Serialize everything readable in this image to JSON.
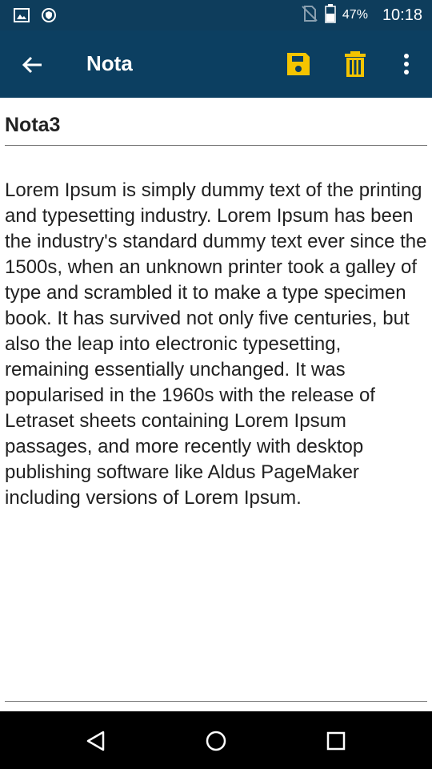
{
  "status_bar": {
    "battery_percent": "47%",
    "time": "10:18",
    "icons": [
      "image-icon",
      "shield-icon",
      "no-sim-icon",
      "battery-icon"
    ]
  },
  "app_bar": {
    "title": "Nota",
    "icons": [
      "back-arrow-icon",
      "save-icon",
      "trash-icon",
      "more-vert-icon"
    ],
    "accent_color": "#f5c400",
    "background_color": "#0c3f61"
  },
  "note": {
    "title": "Nota3",
    "body": "Lorem Ipsum is simply dummy text of the printing and typesetting industry. Lorem Ipsum has been the industry's standard dummy text ever since the 1500s, when an unknown printer took a galley of type and scrambled it to make a type specimen book. It has survived not only five centuries, but also the leap into electronic typesetting, remaining essentially unchanged. It was popularised in the 1960s with the release of Letraset sheets containing Lorem Ipsum passages, and more recently with desktop publishing software like Aldus PageMaker including versions of Lorem Ipsum."
  },
  "nav_bar": {
    "icons": [
      "nav-back-icon",
      "nav-home-icon",
      "nav-recents-icon"
    ]
  }
}
